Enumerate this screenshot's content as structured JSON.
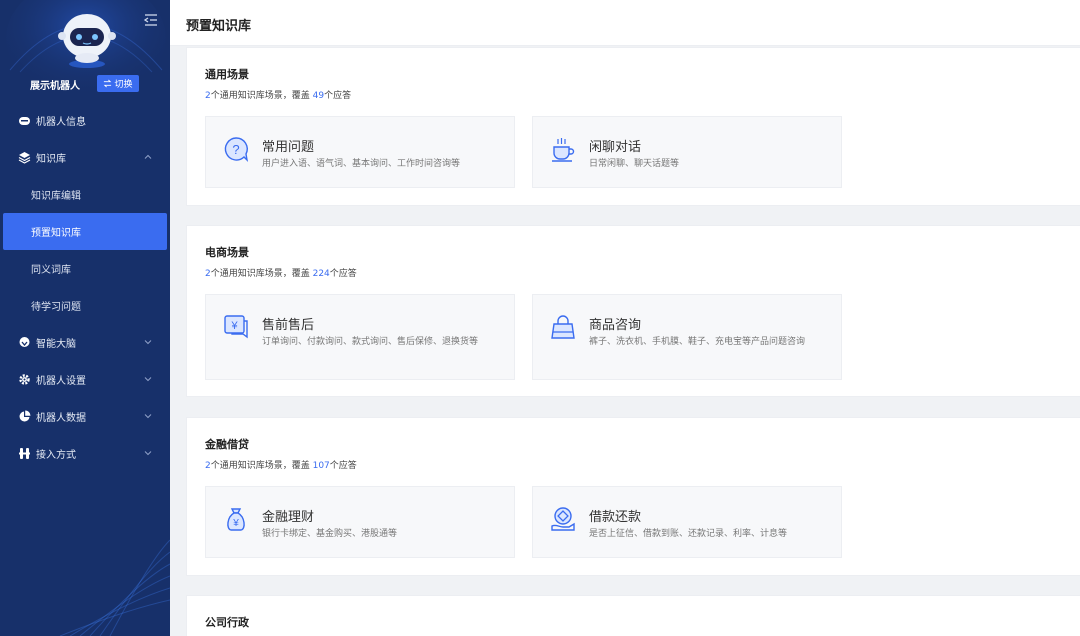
{
  "sidebar": {
    "bot_name": "展示机器人",
    "switch_label": "切换",
    "menu": {
      "bot_info": "机器人信息",
      "knowledge": "知识库",
      "knowledge_edit": "知识库编辑",
      "preset_knowledge": "预置知识库",
      "synonyms": "同义词库",
      "pending": "待学习问题",
      "brain": "智能大脑",
      "settings": "机器人设置",
      "data": "机器人数据",
      "access": "接入方式"
    }
  },
  "page": {
    "title": "预置知识库"
  },
  "sections": [
    {
      "title": "通用场景",
      "sub_pre": "个通用知识库场景，覆盖 ",
      "sub_post": "个应答",
      "count": "2",
      "answers": "49",
      "cards": [
        {
          "title": "常用问题",
          "desc": "用户进入语、语气词、基本询问、工作时间咨询等",
          "icon": "question-bubble-icon"
        },
        {
          "title": "闲聊对话",
          "desc": "日常闲聊、聊天话题等",
          "icon": "coffee-cup-icon"
        }
      ]
    },
    {
      "title": "电商场景",
      "sub_pre": "个通用知识库场景，覆盖 ",
      "sub_post": "个应答",
      "count": "2",
      "answers": "224",
      "cards": [
        {
          "title": "售前售后",
          "desc": "订单询问、付款询问、款式询问、售后保修、退换货等",
          "icon": "yuan-chat-icon"
        },
        {
          "title": "商品咨询",
          "desc": "裤子、洗衣机、手机膜、鞋子、充电宝等产品问题咨询",
          "icon": "shopping-bag-icon"
        }
      ]
    },
    {
      "title": "金融借贷",
      "sub_pre": "个通用知识库场景，覆盖 ",
      "sub_post": "个应答",
      "count": "2",
      "answers": "107",
      "cards": [
        {
          "title": "金融理财",
          "desc": "银行卡绑定、基金购买、港股通等",
          "icon": "money-bag-icon"
        },
        {
          "title": "借款还款",
          "desc": "是否上征信、借款到账、还款记录、利率、计息等",
          "icon": "coin-hand-icon"
        }
      ]
    },
    {
      "title": "公司行政"
    }
  ],
  "colors": {
    "sidebar": "#17306a",
    "accent": "#3a6cf0"
  }
}
